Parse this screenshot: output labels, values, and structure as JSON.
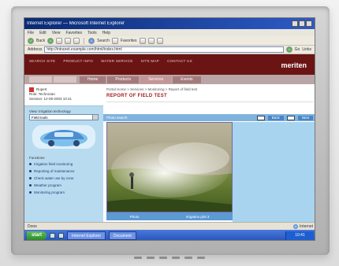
{
  "window": {
    "title": "Internet Explorer — Microsoft Internet Explorer",
    "menu": [
      "File",
      "Edit",
      "View",
      "Favorites",
      "Tools",
      "Help"
    ],
    "toolbar_labels": {
      "back": "Back",
      "search": "Search",
      "favorites": "Favorites"
    },
    "address_label": "Address",
    "address_value": "http://intranet.example.com/html/index.html",
    "go_label": "Go",
    "links_label": "Links"
  },
  "site": {
    "nav": [
      "SEARCH SITE",
      "PRODUCT INFO",
      "WATER SERVICE",
      "SITE MAP",
      "CONTACT US"
    ],
    "brand": "meriten",
    "tabs": [
      "Home",
      "Products",
      "Services",
      "Events"
    ]
  },
  "sidebar": {
    "user_name": "Rupert",
    "user_role": "Role: Technician",
    "user_date": "Session: 12-08-2003 10:41",
    "select_label": "View: Irrigation technology",
    "select_value": "Field tools",
    "links_title": "Functions",
    "links": [
      "Irrigation field monitoring",
      "Reporting of maintenance",
      "Check water use by zone",
      "Weather program",
      "Monitoring program"
    ]
  },
  "main": {
    "breadcrumb": "Portal Home > Services > Monitoring > Report of field test",
    "heading": "REPORT OF FIELD TEST",
    "media_label": "Photo search",
    "media_button_1": "Back",
    "media_button_2": "Next",
    "caption_left": "Photo",
    "caption_right": "Irrigation plot 3"
  },
  "statusbar": {
    "left": "Done",
    "right": "Internet"
  },
  "taskbar": {
    "start": "start",
    "items": [
      "Internet Explorer",
      "Document"
    ],
    "time": "10:41"
  },
  "colors": {
    "header_maroon": "#6b1414",
    "sidebar_blue": "#b9dbf0",
    "heading_red": "#a11c1c"
  }
}
